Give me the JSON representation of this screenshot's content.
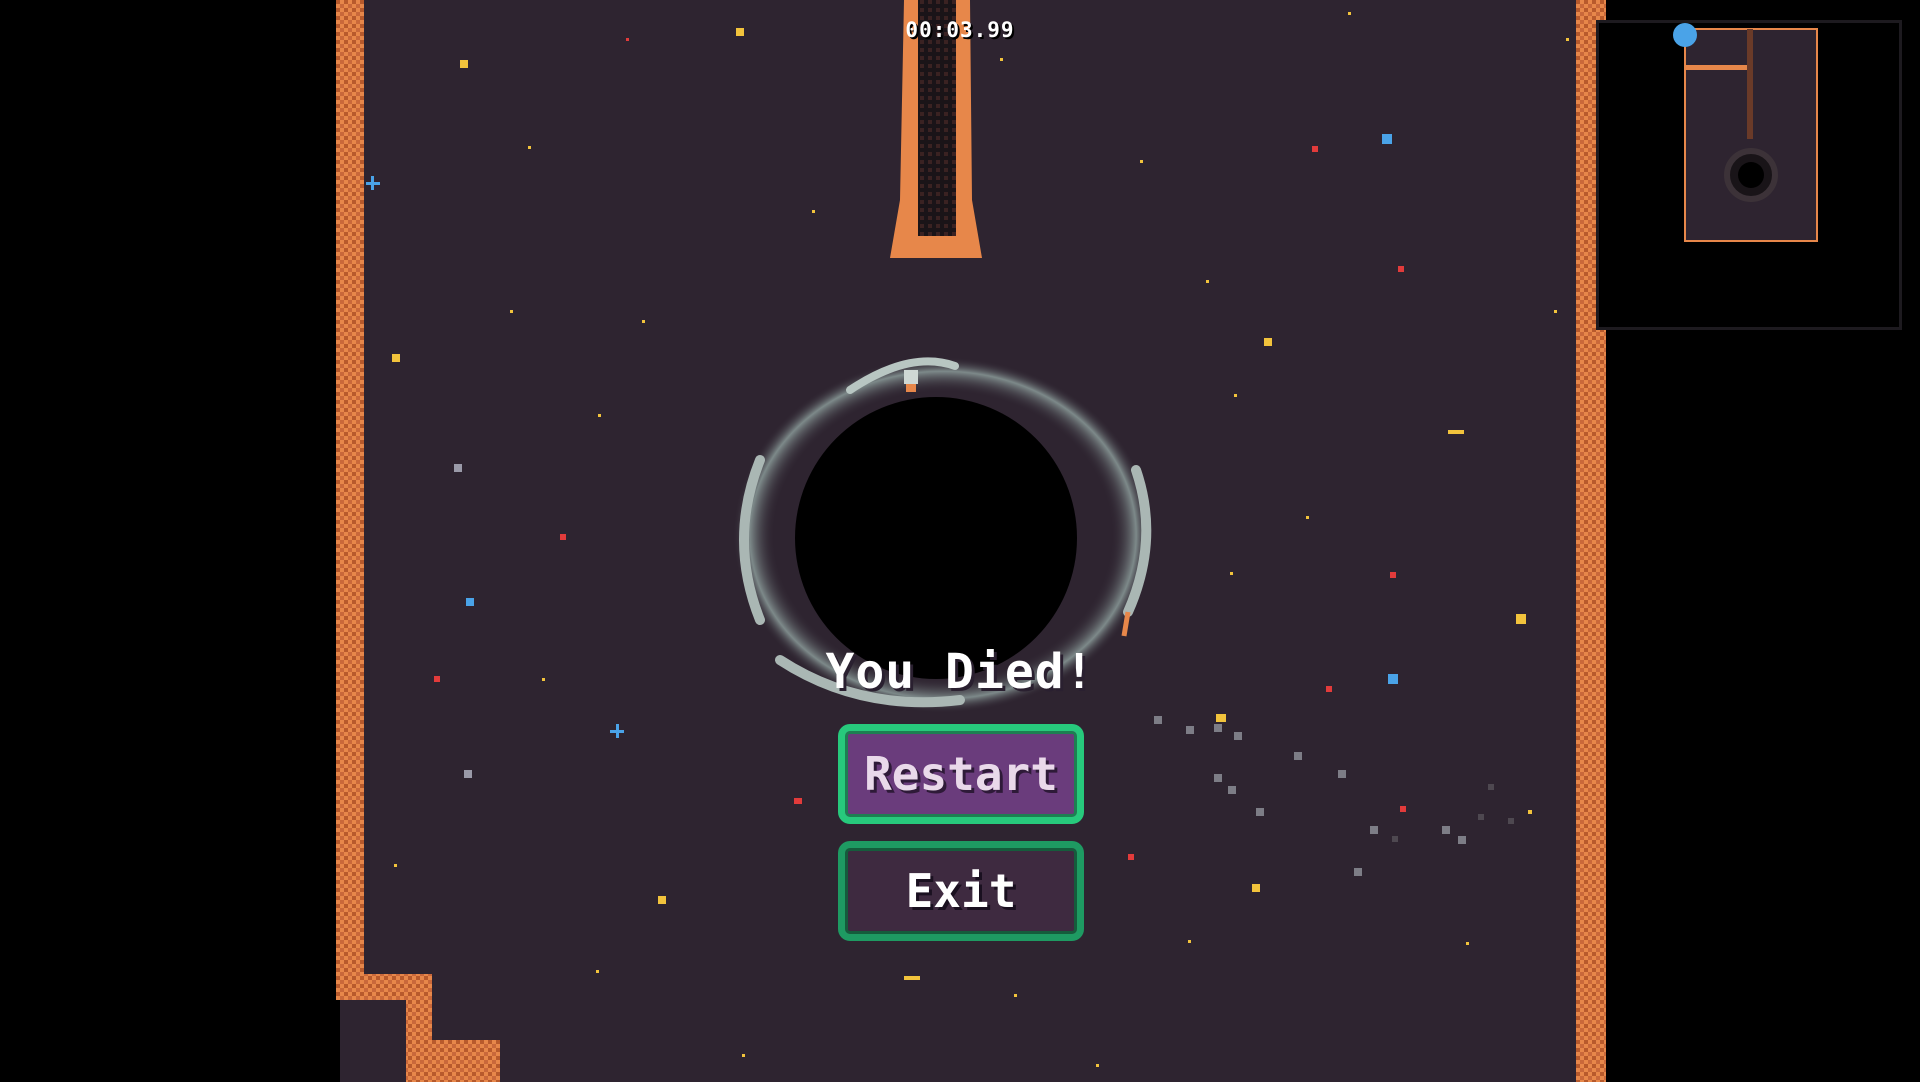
{
  "hud": {
    "timer": "00:03.99"
  },
  "death_screen": {
    "title": "You Died!",
    "restart_label": "Restart",
    "exit_label": "Exit"
  },
  "colors": {
    "background": "#2e2430",
    "wall": "#e7874a",
    "wall_dark": "#b85a2c",
    "button_fill": "#6a3c7c",
    "button_border": "#27c97c",
    "star_yellow": "#f2c33c",
    "star_red": "#e23b3b",
    "star_blue": "#4aa3e8"
  },
  "icons": [
    "black-hole-icon",
    "star-particle-icon",
    "minimap-player-icon"
  ]
}
